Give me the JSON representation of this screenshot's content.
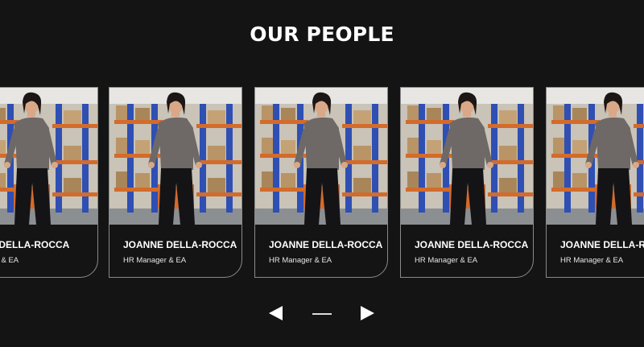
{
  "section": {
    "title": "OUR PEOPLE"
  },
  "people": [
    {
      "name": "JOANNE DELLA-ROCCA",
      "role": "HR Manager & EA"
    },
    {
      "name": "JOANNE DELLA-ROCCA",
      "role": "HR Manager & EA"
    },
    {
      "name": "JOANNE DELLA-ROCCA",
      "role": "HR Manager & EA"
    },
    {
      "name": "JOANNE DELLA-ROCCA",
      "role": "HR Manager & EA"
    },
    {
      "name": "JOANNE DELLA-ROCCA",
      "role": "HR Manager & EA"
    }
  ],
  "carousel": {
    "prev_icon": "arrow-left-icon",
    "next_icon": "arrow-right-icon",
    "indicator": "pagination-dash"
  },
  "colors": {
    "background": "#141414",
    "text": "#ffffff",
    "card_border": "#8a8a8a"
  }
}
